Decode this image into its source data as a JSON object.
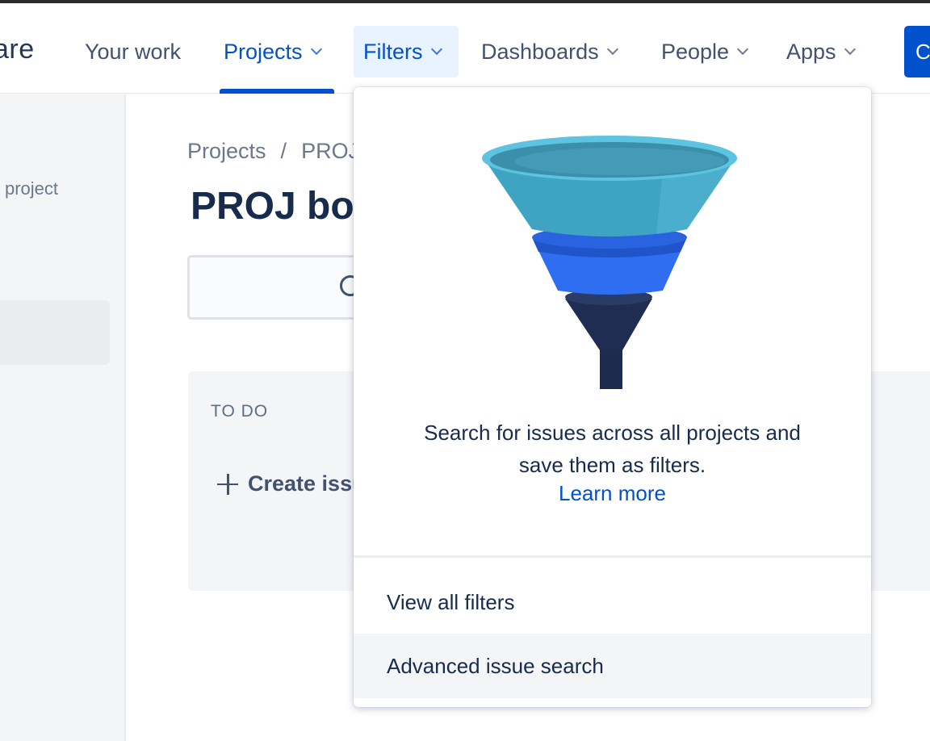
{
  "header": {
    "logo_fragment": "are",
    "nav": [
      {
        "label": "Your work",
        "has_chevron": false,
        "state": "normal"
      },
      {
        "label": "Projects",
        "has_chevron": true,
        "state": "active"
      },
      {
        "label": "Filters",
        "has_chevron": true,
        "state": "open"
      },
      {
        "label": "Dashboards",
        "has_chevron": true,
        "state": "normal"
      },
      {
        "label": "People",
        "has_chevron": true,
        "state": "normal"
      },
      {
        "label": "Apps",
        "has_chevron": true,
        "state": "normal"
      }
    ],
    "create_button_fragment": "C"
  },
  "sidebar": {
    "project_text": "project"
  },
  "main": {
    "breadcrumb": {
      "first": "Projects",
      "separator": "/",
      "second": "PROJ"
    },
    "title": "PROJ board",
    "board": {
      "column_title": "TO DO",
      "create_issue_label": "Create issue"
    }
  },
  "filters_dropdown": {
    "description_line1": "Search for issues across all projects and",
    "description_line2": "save them as filters.",
    "learn_more": "Learn more",
    "items": [
      {
        "label": "View all filters",
        "hovered": false
      },
      {
        "label": "Advanced issue search",
        "hovered": true
      }
    ]
  },
  "colors": {
    "brand_blue": "#0052cc",
    "text_dark": "#172b4d",
    "text_muted": "#42526e",
    "open_menu_bg": "#e9f2ff"
  }
}
